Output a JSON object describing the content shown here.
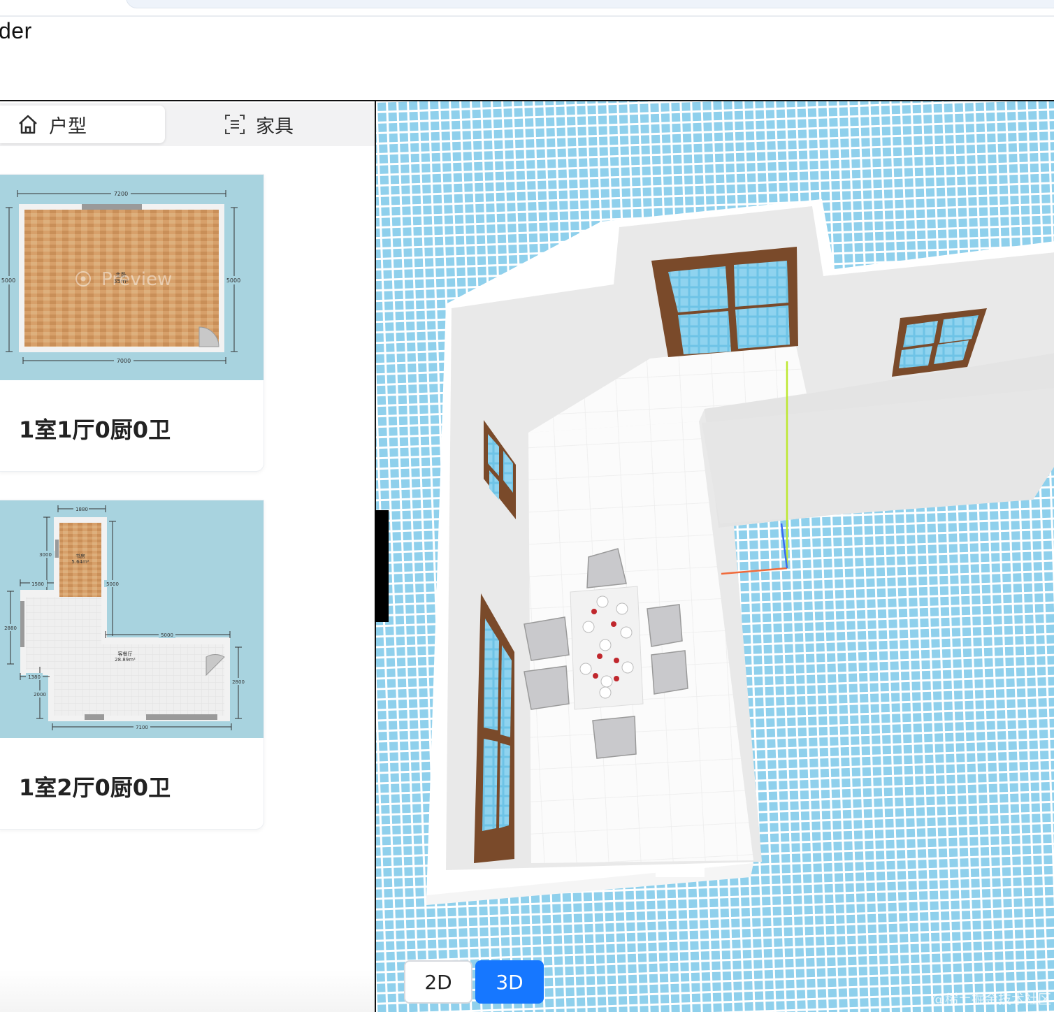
{
  "header": {
    "title_fragment": "der"
  },
  "tabs": [
    {
      "label": "户型",
      "icon": "home-icon",
      "active": true
    },
    {
      "label": "家具",
      "icon": "scan-icon",
      "active": false
    }
  ],
  "floorplans": [
    {
      "name": "1室1厅0厨0卫",
      "dims": {
        "top": "7200",
        "bottom": "7000",
        "left": "5000",
        "right": "5000"
      },
      "room": {
        "name": "主卧",
        "area": "35m²"
      },
      "overlay": "Preview"
    },
    {
      "name": "1室2厅0厨0卫",
      "dims": {
        "d1": "1880",
        "d2": "3000",
        "d3": "1580",
        "d4": "5000",
        "d5": "2880",
        "d6": "5000",
        "d7": "1380",
        "d8": "2000",
        "d9": "2800",
        "d10": "7100"
      },
      "rooms": [
        {
          "name": "书房",
          "area": "5.64m²"
        },
        {
          "name": "客餐厅",
          "area": "28.89m²"
        }
      ]
    }
  ],
  "view_toggle": {
    "options": [
      "2D",
      "3D"
    ],
    "selected": "3D"
  },
  "watermark": "@稀土掘金技术社区",
  "colors": {
    "accent": "#1677ff",
    "floor_grid": "#8fd0ec",
    "thumb_bg": "#a8d8e6",
    "wood": "#d9a066"
  }
}
